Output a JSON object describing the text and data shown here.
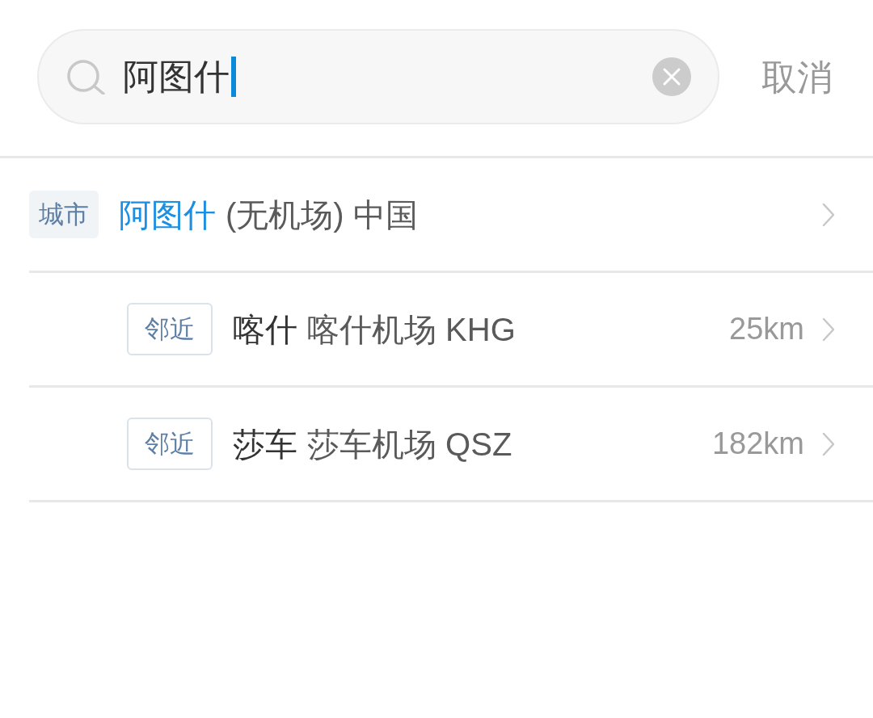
{
  "search": {
    "value": "阿图什",
    "focused": true,
    "cancel": "取消"
  },
  "results": [
    {
      "kind": "city",
      "tag": "城市",
      "name": "阿图什",
      "detail": "(无机场) 中国",
      "children": [
        {
          "kind": "nearby",
          "tag": "邻近",
          "name": "喀什",
          "detail": "喀什机场 KHG",
          "distance": "25km"
        },
        {
          "kind": "nearby",
          "tag": "邻近",
          "name": "莎车",
          "detail": "莎车机场 QSZ",
          "distance": "182km"
        }
      ]
    }
  ]
}
